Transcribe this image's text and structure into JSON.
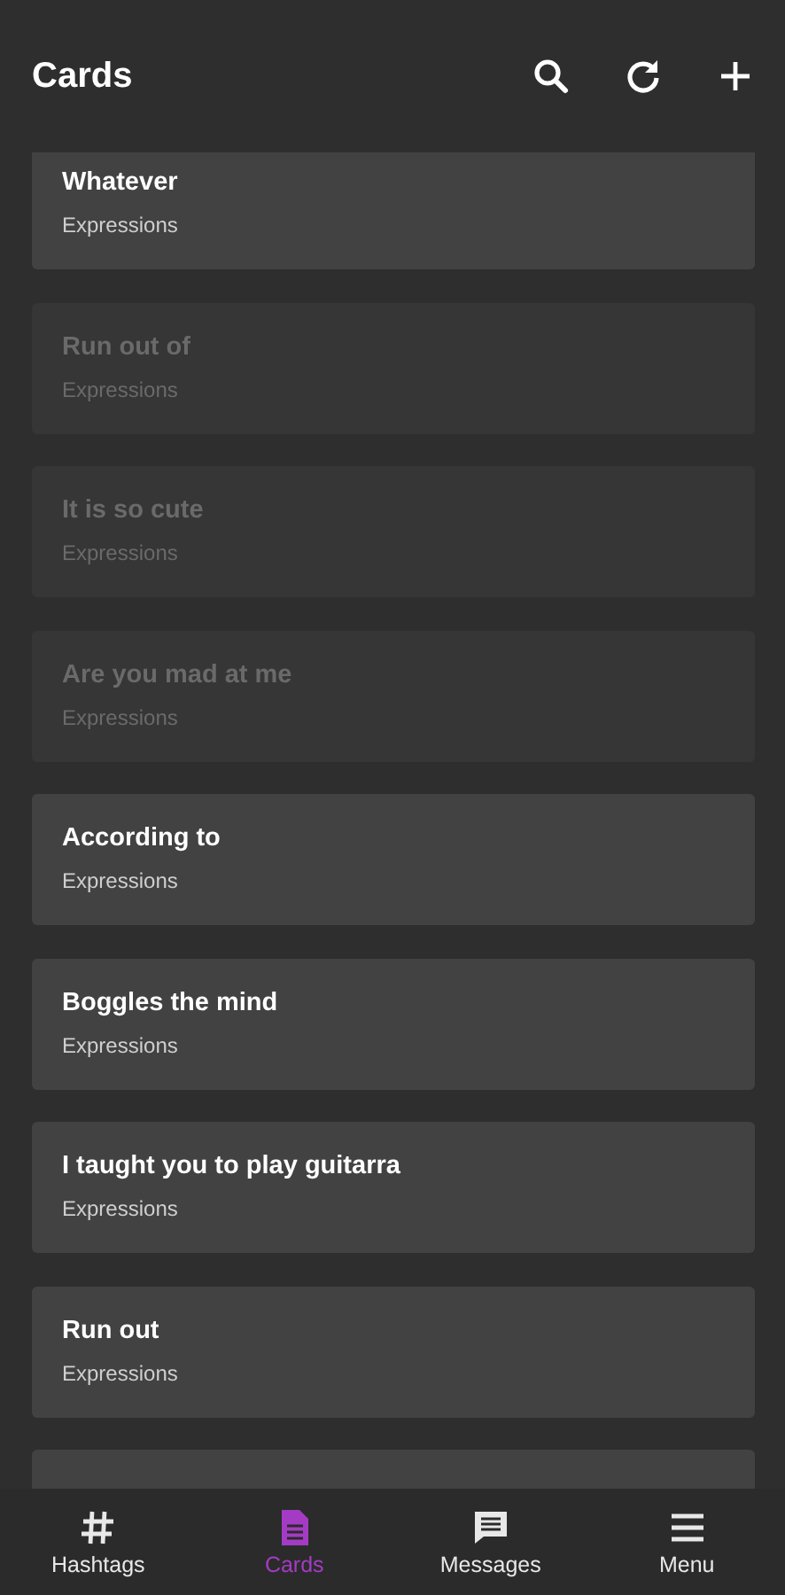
{
  "app_bar": {
    "title": "Cards",
    "actions": [
      {
        "kind": "search"
      },
      {
        "kind": "refresh"
      },
      {
        "kind": "add"
      }
    ]
  },
  "cards": [
    {
      "kind": "card",
      "title": "Whatever",
      "subtitle": "Expressions",
      "disabled": false
    },
    {
      "kind": "card",
      "title": "Run out of",
      "subtitle": "Expressions",
      "disabled": true
    },
    {
      "kind": "card",
      "title": "It is so cute",
      "subtitle": "Expressions",
      "disabled": true
    },
    {
      "kind": "card",
      "title": "Are you mad at me",
      "subtitle": "Expressions",
      "disabled": true
    },
    {
      "kind": "card",
      "title": "According to",
      "subtitle": "Expressions",
      "disabled": false
    },
    {
      "kind": "card",
      "title": "Boggles the mind",
      "subtitle": "Expressions",
      "disabled": false
    },
    {
      "kind": "card",
      "title": "I taught you to play guitarra",
      "subtitle": "Expressions",
      "disabled": false
    },
    {
      "kind": "card",
      "title": "Run out",
      "subtitle": "Expressions",
      "disabled": false
    },
    {
      "kind": "clipped"
    }
  ],
  "bottom_nav": [
    {
      "kind": "hashtag",
      "label": "Hashtags",
      "selected": false
    },
    {
      "kind": "document",
      "label": "Cards",
      "selected": true
    },
    {
      "kind": "message",
      "label": "Messages",
      "selected": false
    },
    {
      "kind": "menu",
      "label": "Menu",
      "selected": false
    }
  ]
}
